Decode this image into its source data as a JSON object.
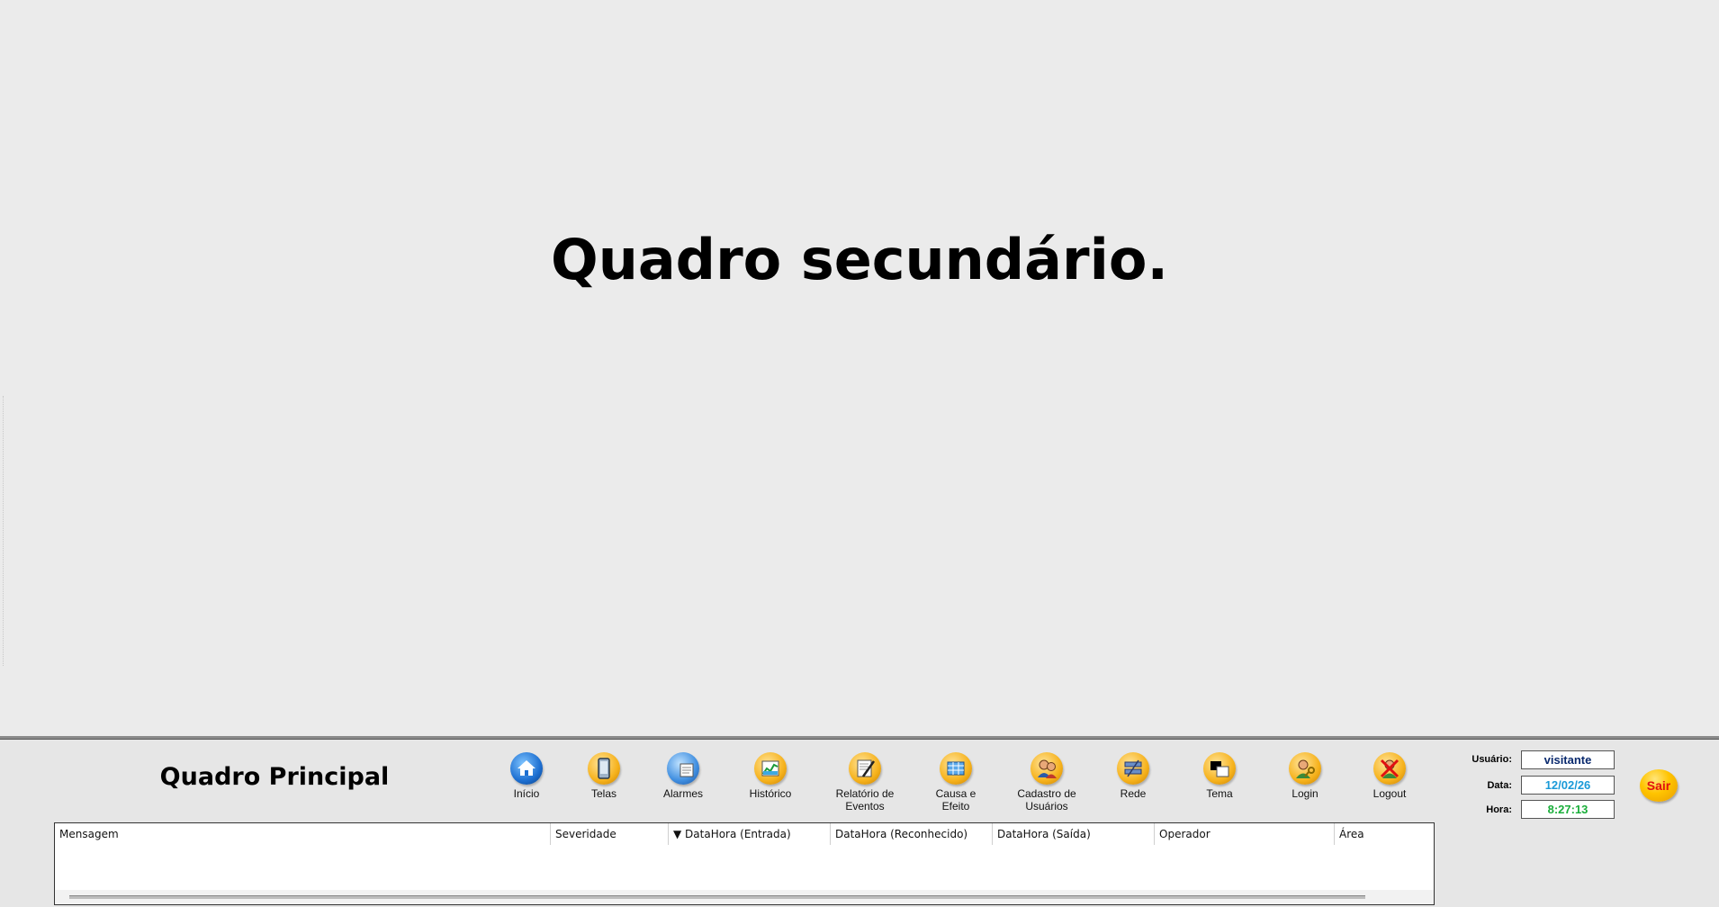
{
  "secondary_frame": {
    "title": "Quadro secundário."
  },
  "main_frame": {
    "title": "Quadro Principal",
    "nav": [
      {
        "label": "Início",
        "icon": "home-icon"
      },
      {
        "label": "Telas",
        "icon": "screens-icon"
      },
      {
        "label": "Alarmes",
        "icon": "alarms-icon"
      },
      {
        "label": "Histórico",
        "icon": "history-icon"
      },
      {
        "label": "Relatório de\nEventos",
        "icon": "event-report-icon"
      },
      {
        "label": "Causa e\nEfeito",
        "icon": "cause-effect-icon"
      },
      {
        "label": "Cadastro de\nUsuários",
        "icon": "users-icon"
      },
      {
        "label": "Rede",
        "icon": "network-icon"
      },
      {
        "label": "Tema",
        "icon": "theme-icon"
      },
      {
        "label": "Login",
        "icon": "login-icon"
      },
      {
        "label": "Logout",
        "icon": "logout-icon"
      }
    ],
    "info": {
      "user_label": "Usuário:",
      "user_value": "visitante",
      "date_label": "Data:",
      "date_value": "12/02/26",
      "time_label": "Hora:",
      "time_value": "8:27:13"
    },
    "exit_label": "Sair",
    "alarm_table": {
      "columns": [
        "Mensagem",
        "Severidade",
        "▼ DataHora (Entrada)",
        "DataHora (Reconhecido)",
        "DataHora (Saída)",
        "Operador",
        "Área"
      ],
      "rows": []
    }
  },
  "colors": {
    "background": "#ebebeb",
    "panel": "#e6e6e6",
    "user_text": "#0a2a6e",
    "date_text": "#1a9ad8",
    "time_text": "#1aae3a",
    "exit_text": "#e01010",
    "exit_button": "#ffc400"
  }
}
